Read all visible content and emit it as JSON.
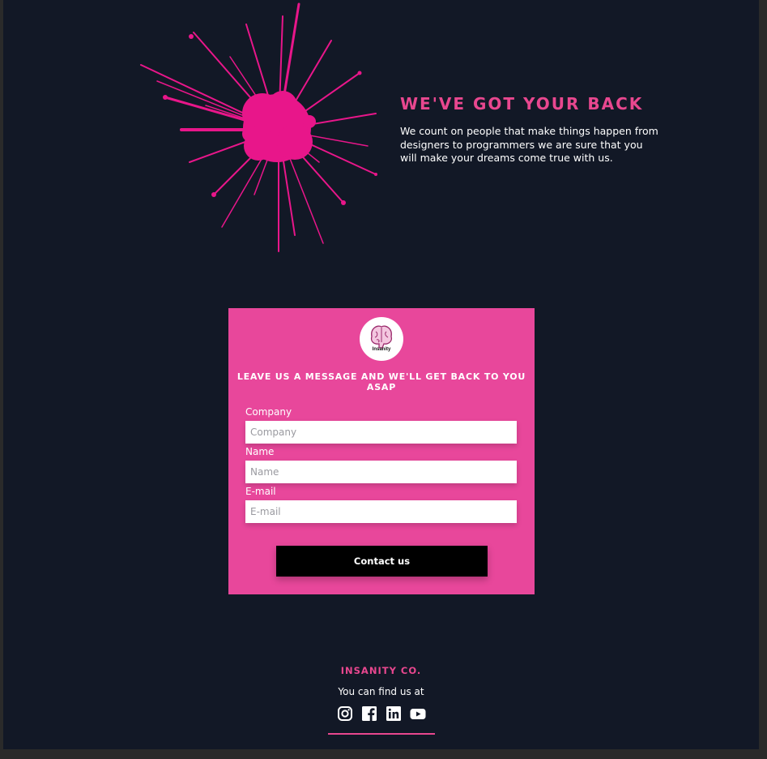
{
  "hero": {
    "title": "WE'VE GOT YOUR BACK",
    "description": "We count on people that make things happen from designers to programmers we are sure that you will make your dreams come true with us."
  },
  "contact_form": {
    "logo_text": "Insanity",
    "heading": "LEAVE US A MESSAGE AND WE'LL GET BACK TO YOU ASAP",
    "fields": [
      {
        "label": "Company",
        "placeholder": "Company"
      },
      {
        "label": "Name",
        "placeholder": "Name"
      },
      {
        "label": "E-mail",
        "placeholder": "E-mail"
      }
    ],
    "submit_label": "Contact us"
  },
  "footer": {
    "brand": "INSANITY CO.",
    "find_us": "You can find us at",
    "socials": [
      {
        "icon": "instagram-icon"
      },
      {
        "icon": "facebook-icon"
      },
      {
        "icon": "linkedin-icon"
      },
      {
        "icon": "youtube-icon"
      }
    ]
  },
  "colors": {
    "background": "#121826",
    "accent": "#e8478f",
    "card": "#e8479b",
    "button": "#000000"
  }
}
